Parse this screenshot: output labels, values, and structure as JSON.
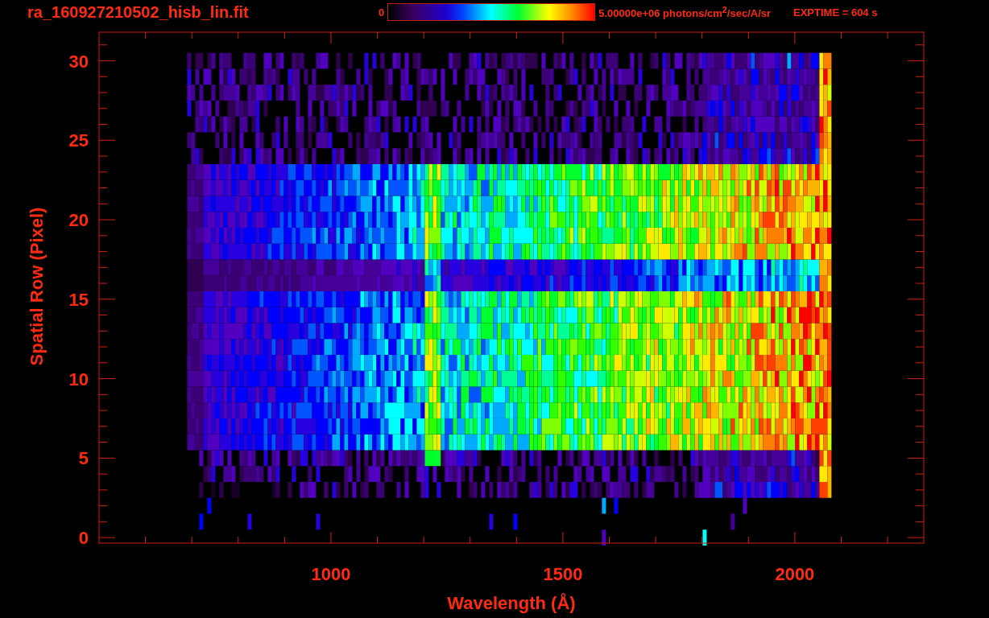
{
  "title": "ra_160927210502_hisb_lin.fit",
  "colorbar": {
    "min_label": "0",
    "max_label": "5.00000e+06 photons/cm$^{2}$/sec/A/sr"
  },
  "exposure": "EXPTIME = 604 s",
  "plot": {
    "xlabel": "Wavelength (Å)",
    "ylabel": "Spatial Row (Pixel)",
    "xticks": [
      "1000",
      "1500",
      "2000"
    ],
    "yticks": [
      "30",
      "25",
      "20",
      "15",
      "10",
      "5",
      "0"
    ]
  }
}
